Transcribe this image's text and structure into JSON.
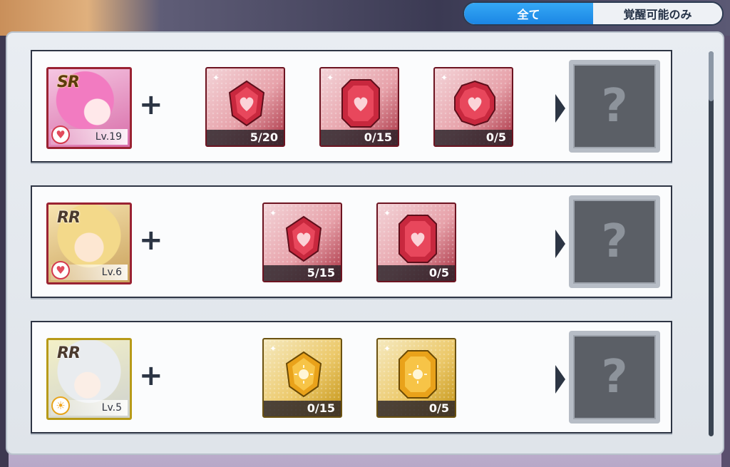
{
  "filter": {
    "all_label": "全て",
    "awakenable_label": "覚醒可能のみ",
    "selected": "全て"
  },
  "rows": [
    {
      "rarity": "SR",
      "level": "Lv.19",
      "attribute_icon": "heart-icon",
      "frame_color": "#9a2232",
      "materials": [
        {
          "count": "5/20",
          "gem_icon": "red-heart-gem-small-icon"
        },
        {
          "count": "0/15",
          "gem_icon": "red-heart-gem-medium-icon"
        },
        {
          "count": "0/5",
          "gem_icon": "red-heart-gem-large-icon"
        }
      ],
      "result": "?"
    },
    {
      "rarity": "RR",
      "level": "Lv.6",
      "attribute_icon": "heart-icon",
      "frame_color": "#9a2232",
      "materials": [
        {
          "count": "5/15",
          "gem_icon": "red-heart-gem-small-icon"
        },
        {
          "count": "0/5",
          "gem_icon": "red-heart-gem-medium-icon"
        }
      ],
      "result": "?"
    },
    {
      "rarity": "RR",
      "level": "Lv.5",
      "attribute_icon": "sun-icon",
      "frame_color": "#b79a18",
      "materials": [
        {
          "count": "0/15",
          "gem_icon": "gold-sun-gem-small-icon"
        },
        {
          "count": "0/5",
          "gem_icon": "gold-sun-gem-medium-icon"
        }
      ],
      "result": "?"
    }
  ],
  "colors": {
    "accent": "#1b86e4",
    "red_gem": "#c8283e",
    "gold_gem": "#e9a21a"
  }
}
